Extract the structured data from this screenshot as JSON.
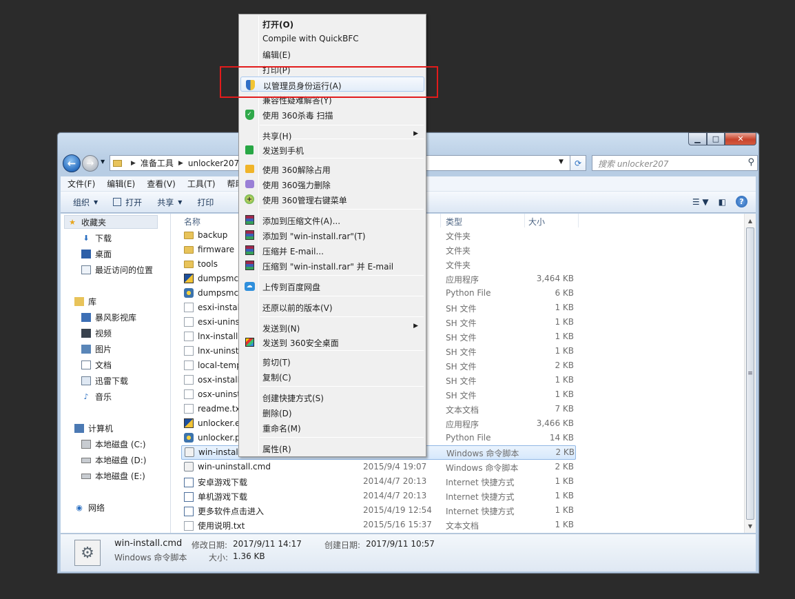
{
  "window": {
    "nav": {
      "breadcrumb": [
        "准备工具",
        "unlocker207"
      ],
      "search_placeholder": "搜索 unlocker207"
    },
    "menubar": [
      "文件(F)",
      "编辑(E)",
      "查看(V)",
      "工具(T)",
      "帮助(H)"
    ],
    "toolbar": {
      "organize": "组织",
      "open": "打开",
      "share": "共享",
      "print": "打印"
    },
    "navpane": {
      "favorites": {
        "title": "收藏夹",
        "items": [
          "下载",
          "桌面",
          "最近访问的位置"
        ]
      },
      "libraries": {
        "title": "库",
        "items": [
          "暴风影视库",
          "视频",
          "图片",
          "文档",
          "迅雷下载",
          "音乐"
        ]
      },
      "computer": {
        "title": "计算机",
        "items": [
          "本地磁盘 (C:)",
          "本地磁盘 (D:)",
          "本地磁盘 (E:)"
        ]
      },
      "network": {
        "title": "网络"
      }
    },
    "columns": {
      "name": "名称",
      "type": "类型",
      "size": "大小"
    },
    "files": [
      {
        "name": "backup",
        "date": "",
        "type": "文件夹",
        "size": "",
        "icon": "folder"
      },
      {
        "name": "firmware",
        "date": "",
        "type": "文件夹",
        "size": "",
        "icon": "folder"
      },
      {
        "name": "tools",
        "date": "",
        "type": "文件夹",
        "size": "",
        "icon": "folder"
      },
      {
        "name": "dumpsmc.",
        "date": "",
        "type": "应用程序",
        "size": "3,464 KB",
        "icon": "exe"
      },
      {
        "name": "dumpsmc.",
        "date": "",
        "type": "Python File",
        "size": "6 KB",
        "icon": "py"
      },
      {
        "name": "esxi-install",
        "date": "",
        "type": "SH 文件",
        "size": "1 KB",
        "icon": "file"
      },
      {
        "name": "esxi-uninst",
        "date": "",
        "type": "SH 文件",
        "size": "1 KB",
        "icon": "file"
      },
      {
        "name": "lnx-install.s",
        "date": "",
        "type": "SH 文件",
        "size": "1 KB",
        "icon": "file"
      },
      {
        "name": "lnx-uninsta",
        "date": "",
        "type": "SH 文件",
        "size": "1 KB",
        "icon": "file"
      },
      {
        "name": "local-temp",
        "date": "",
        "type": "SH 文件",
        "size": "2 KB",
        "icon": "file"
      },
      {
        "name": "osx-install.",
        "date": "",
        "type": "SH 文件",
        "size": "1 KB",
        "icon": "file"
      },
      {
        "name": "osx-uninst",
        "date": "",
        "type": "SH 文件",
        "size": "1 KB",
        "icon": "file"
      },
      {
        "name": "readme.txt",
        "date": "",
        "type": "文本文档",
        "size": "7 KB",
        "icon": "file"
      },
      {
        "name": "unlocker.e",
        "date": "",
        "type": "应用程序",
        "size": "3,466 KB",
        "icon": "exe"
      },
      {
        "name": "unlocker.p",
        "date": "",
        "type": "Python File",
        "size": "14 KB",
        "icon": "py"
      },
      {
        "name": "win-install.",
        "date": "",
        "type": "Windows 命令脚本",
        "size": "2 KB",
        "icon": "cmd",
        "selected": true
      },
      {
        "name": "win-uninstall.cmd",
        "date": "2015/9/4 19:07",
        "type": "Windows 命令脚本",
        "size": "2 KB",
        "icon": "cmd"
      },
      {
        "name": "安卓游戏下载",
        "date": "2014/4/7 20:13",
        "type": "Internet 快捷方式",
        "size": "1 KB",
        "icon": "link"
      },
      {
        "name": "单机游戏下载",
        "date": "2014/4/7 20:13",
        "type": "Internet 快捷方式",
        "size": "1 KB",
        "icon": "link"
      },
      {
        "name": "更多软件点击进入",
        "date": "2015/4/19 12:54",
        "type": "Internet 快捷方式",
        "size": "1 KB",
        "icon": "link"
      },
      {
        "name": "使用说明.txt",
        "date": "2015/5/16 15:37",
        "type": "文本文档",
        "size": "1 KB",
        "icon": "file"
      }
    ],
    "details": {
      "filename": "win-install.cmd",
      "filetype": "Windows 命令脚本",
      "modified_label": "修改日期:",
      "modified": "2017/9/11 14:17",
      "created_label": "创建日期:",
      "created": "2017/9/11 10:57",
      "size_label": "大小:",
      "size": "1.36 KB"
    }
  },
  "context_menu": {
    "items": [
      {
        "label": "打开(O)",
        "bold": true
      },
      {
        "label": "Compile with QuickBFC"
      },
      {
        "label": "编辑(E)"
      },
      {
        "label": "打印(P)"
      },
      {
        "label": "以管理员身份运行(A)",
        "icon": "uac-shield-icon",
        "highlighted": true
      },
      {
        "label": "兼容性疑难解答(Y)"
      },
      {
        "label": "使用 360杀毒 扫描",
        "icon": "360-shield-icon"
      },
      {
        "label": "共享(H)",
        "submenu": true
      },
      {
        "label": "发送到手机",
        "icon": "phone-icon"
      },
      {
        "label": "使用 360解除占用",
        "icon": "unlock-icon"
      },
      {
        "label": "使用 360强力删除",
        "icon": "shred-icon"
      },
      {
        "label": "使用 360管理右键菜单",
        "icon": "menu-manage-icon"
      },
      {
        "label": "添加到压缩文件(A)...",
        "icon": "winrar-icon"
      },
      {
        "label": "添加到 \"win-install.rar\"(T)",
        "icon": "winrar-icon"
      },
      {
        "label": "压缩并 E-mail...",
        "icon": "winrar-icon"
      },
      {
        "label": "压缩到 \"win-install.rar\" 并 E-mail",
        "icon": "winrar-icon"
      },
      {
        "label": "上传到百度网盘",
        "icon": "cloud-icon"
      },
      {
        "label": "还原以前的版本(V)"
      },
      {
        "label": "发送到(N)",
        "submenu": true
      },
      {
        "label": "发送到 360安全桌面",
        "icon": "desktop-icon"
      },
      {
        "label": "剪切(T)"
      },
      {
        "label": "复制(C)"
      },
      {
        "label": "创建快捷方式(S)"
      },
      {
        "label": "删除(D)"
      },
      {
        "label": "重命名(M)"
      },
      {
        "label": "属性(R)"
      }
    ]
  }
}
